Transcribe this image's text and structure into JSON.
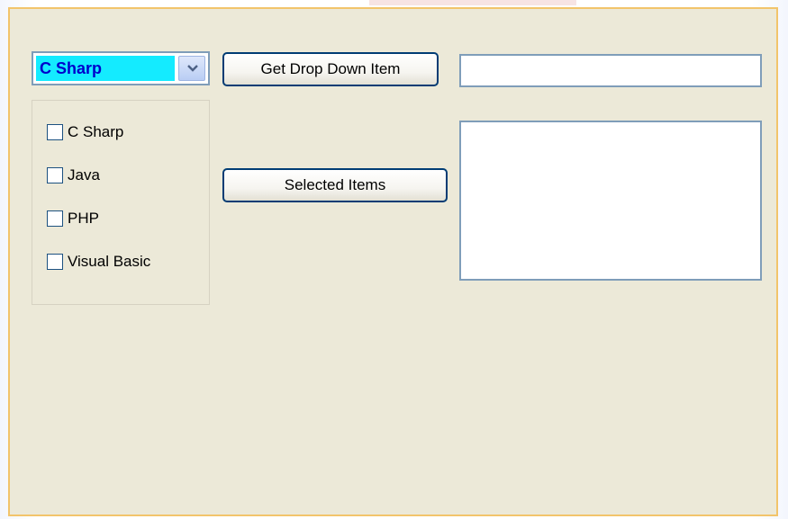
{
  "window": {
    "accent_border": "#f2c46b",
    "background": "#ece9d8"
  },
  "dropdown": {
    "selected_value": "C Sharp",
    "highlight_color": "#14ebff",
    "arrow_icon": "chevron-down-icon"
  },
  "buttons": {
    "get_drop_down_item": "Get Drop Down Item",
    "selected_items": "Selected Items"
  },
  "textbox": {
    "value": ""
  },
  "listbox": {
    "items": []
  },
  "checkboxes": [
    {
      "label": "C Sharp",
      "checked": false
    },
    {
      "label": "Java",
      "checked": false
    },
    {
      "label": "PHP",
      "checked": false
    },
    {
      "label": "Visual Basic",
      "checked": false
    }
  ]
}
